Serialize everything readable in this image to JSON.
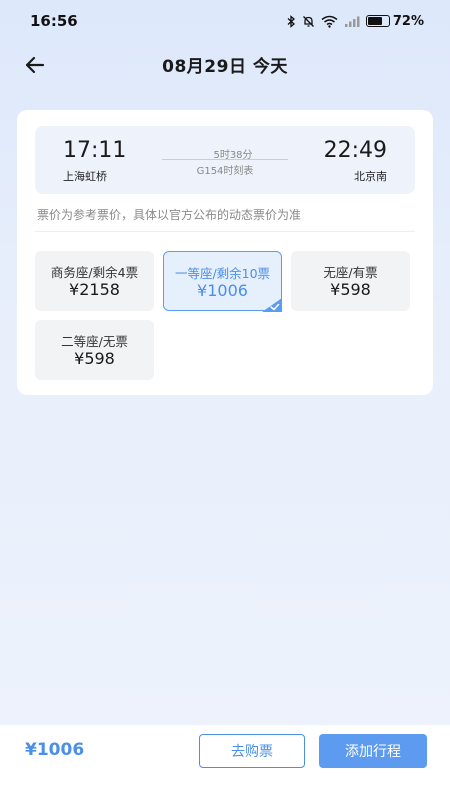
{
  "status_bar": {
    "time": "16:56",
    "battery_percent": "72%",
    "battery_level": 0.72,
    "icons": [
      "bluetooth-icon",
      "mute-bell-icon",
      "wifi-icon",
      "signal-icon",
      "battery-icon"
    ]
  },
  "header": {
    "back_icon": "arrow-left-icon",
    "title": "08月29日 今天"
  },
  "trip": {
    "departure_time": "17:11",
    "departure_station": "上海虹桥",
    "arrival_time": "22:49",
    "arrival_station": "北京南",
    "duration": "5时38分",
    "train_schedule": "G154时刻表"
  },
  "note": "票价为参考票价，具体以官方公布的动态票价为准",
  "seats": [
    {
      "name": "商务座/剩余4票",
      "price": "¥2158",
      "selected": false
    },
    {
      "name": "一等座/剩余10票",
      "price": "¥1006",
      "selected": true
    },
    {
      "name": "无座/有票",
      "price": "¥598",
      "selected": false
    },
    {
      "name": "二等座/无票",
      "price": "¥598",
      "selected": false
    }
  ],
  "bottom_bar": {
    "total_price": "¥1006",
    "buy_label": "去购票",
    "add_label": "添加行程"
  },
  "colors": {
    "accent": "#4a8fe8",
    "primary_button": "#5c9bef"
  }
}
